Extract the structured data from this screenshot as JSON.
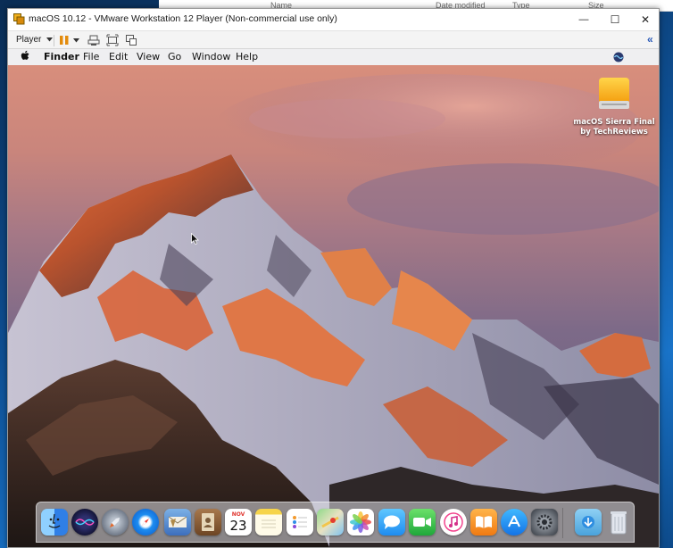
{
  "explorer": {
    "columns": [
      "Name",
      "Date modified",
      "Type",
      "Size"
    ]
  },
  "vm": {
    "title": "macOS 10.12 - VMware Workstation 12 Player (Non-commercial use only)",
    "player_label": "Player",
    "controls": {
      "minimize": "—",
      "maximize": "☐",
      "close": "✕"
    },
    "toolbar_icons": [
      "pause-icon",
      "send-ctrl-alt-del-icon",
      "full-screen-icon",
      "unity-icon"
    ],
    "collapse_label": "«"
  },
  "mac": {
    "menubar": {
      "apple": "",
      "items": [
        "Finder",
        "File",
        "Edit",
        "View",
        "Go",
        "Window",
        "Help"
      ]
    },
    "desktop_icon": {
      "line1": "macOS Sierra Final",
      "line2": "by TechReviews"
    },
    "dock": {
      "calendar_month": "NOV",
      "calendar_day": "23",
      "apps": [
        "Finder",
        "Siri",
        "Launchpad",
        "Safari",
        "Mail",
        "Contacts",
        "Calendar",
        "Notes",
        "Reminders",
        "Maps",
        "Photos",
        "Messages",
        "FaceTime",
        "iTunes",
        "iBooks",
        "App Store",
        "System Preferences",
        "Downloads",
        "Trash"
      ]
    }
  },
  "colors": {
    "accent": "#0a64d8",
    "mountain_glow": "#e8703a",
    "sky_pink": "#c98a9b"
  }
}
